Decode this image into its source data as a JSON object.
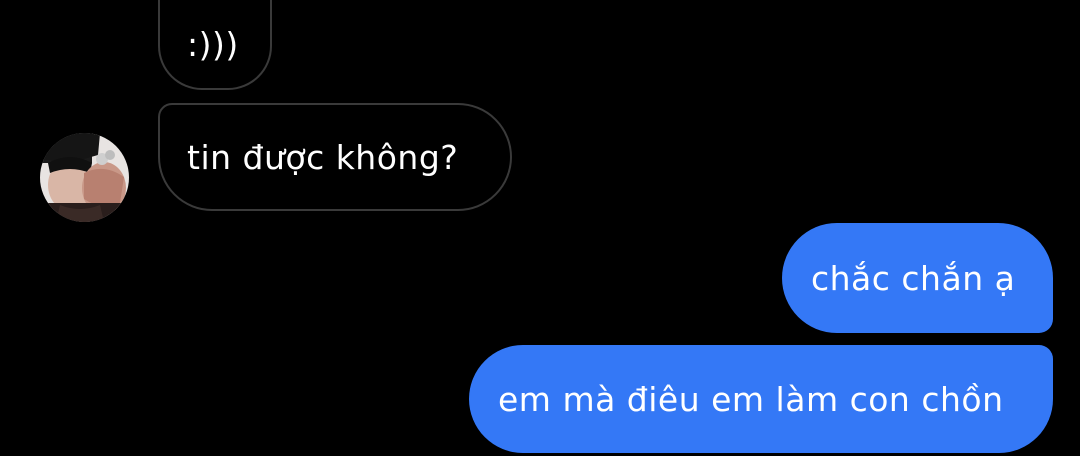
{
  "messages": [
    {
      "id": "msg-1",
      "direction": "incoming",
      "text": ":)))"
    },
    {
      "id": "msg-2",
      "direction": "incoming",
      "text": "tin được không?"
    },
    {
      "id": "msg-3",
      "direction": "outgoing",
      "text": "chắc chắn ạ"
    },
    {
      "id": "msg-4",
      "direction": "outgoing",
      "text": "em mà  điêu em làm con chồn"
    }
  ],
  "sender": {
    "avatar_icon": "profile-photo"
  },
  "colors": {
    "background": "#000000",
    "incoming_border": "#3a3a3a",
    "outgoing_bubble": "#3478f6",
    "text": "#ffffff"
  }
}
